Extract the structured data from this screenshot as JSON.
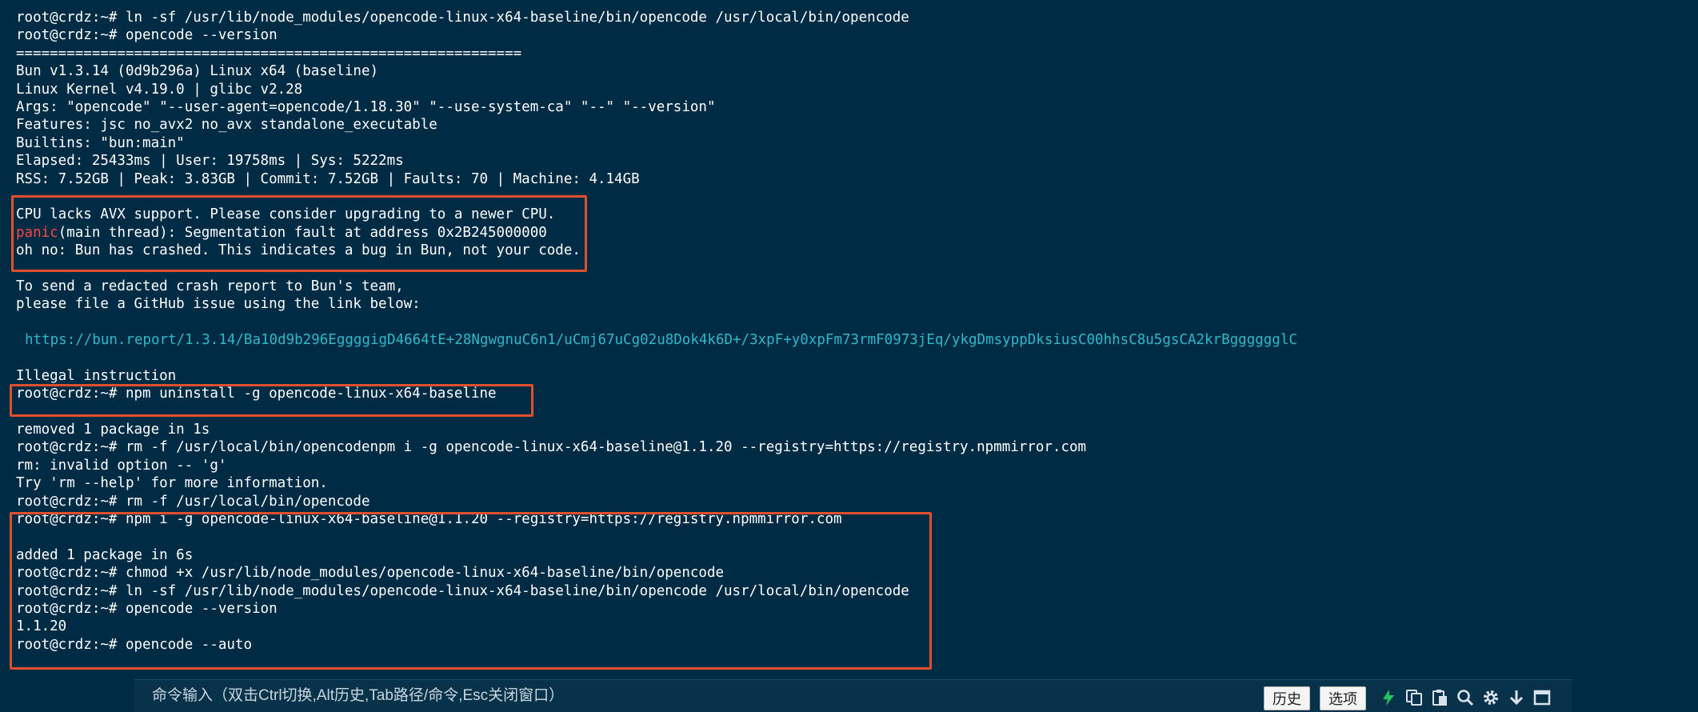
{
  "terminal": {
    "lines": [
      {
        "text": "root@crdz:~# ln -sf /usr/lib/node_modules/opencode-linux-x64-baseline/bin/opencode /usr/local/bin/opencode"
      },
      {
        "text": "root@crdz:~# opencode --version"
      },
      {
        "text": "============================================================"
      },
      {
        "text": "Bun v1.3.14 (0d9b296a) Linux x64 (baseline)"
      },
      {
        "text": "Linux Kernel v4.19.0 | glibc v2.28"
      },
      {
        "text": "Args: \"opencode\" \"--user-agent=opencode/1.18.30\" \"--use-system-ca\" \"--\" \"--version\""
      },
      {
        "text": "Features: jsc no_avx2 no_avx standalone_executable"
      },
      {
        "text": "Builtins: \"bun:main\""
      },
      {
        "text": "Elapsed: 25433ms | User: 19758ms | Sys: 5222ms"
      },
      {
        "text": "RSS: 7.52GB | Peak: 3.83GB | Commit: 7.52GB | Faults: 70 | Machine: 4.14GB"
      },
      {
        "text": ""
      },
      {
        "text": "CPU lacks AVX support. Please consider upgrading to a newer CPU."
      },
      {
        "prefix": "panic",
        "text": "(main thread): Segmentation fault at address 0x2B245000000"
      },
      {
        "text": "oh no: Bun has crashed. This indicates a bug in Bun, not your code."
      },
      {
        "text": ""
      },
      {
        "text": "To send a redacted crash report to Bun's team,"
      },
      {
        "text": "please file a GitHub issue using the link below:"
      },
      {
        "text": ""
      },
      {
        "link": true,
        "text": "https://bun.report/1.3.14/Ba10d9b296EggggigD4664tE+28NgwgnuC6n1/uCmj67uCg02u8Dok4k6D+/3xpF+y0xpFm73rmF0973jEq/ykgDmsyppDksiusC00hhsC8u5gsCA2krBgggggglC"
      },
      {
        "text": ""
      },
      {
        "text": "Illegal instruction"
      },
      {
        "text": "root@crdz:~# npm uninstall -g opencode-linux-x64-baseline"
      },
      {
        "text": ""
      },
      {
        "text": "removed 1 package in 1s"
      },
      {
        "text": "root@crdz:~# rm -f /usr/local/bin/opencodenpm i -g opencode-linux-x64-baseline@1.1.20 --registry=https://registry.npmmirror.com"
      },
      {
        "text": "rm: invalid option -- 'g'"
      },
      {
        "text": "Try 'rm --help' for more information."
      },
      {
        "text": "root@crdz:~# rm -f /usr/local/bin/opencode"
      },
      {
        "text": "root@crdz:~# npm i -g opencode-linux-x64-baseline@1.1.20 --registry=https://registry.npmmirror.com"
      },
      {
        "text": ""
      },
      {
        "text": "added 1 package in 6s"
      },
      {
        "text": "root@crdz:~# chmod +x /usr/lib/node_modules/opencode-linux-x64-baseline/bin/opencode"
      },
      {
        "text": "root@crdz:~# ln -sf /usr/lib/node_modules/opencode-linux-x64-baseline/bin/opencode /usr/local/bin/opencode"
      },
      {
        "text": "root@crdz:~# opencode --version"
      },
      {
        "text": "1.1.20"
      },
      {
        "text": "root@crdz:~# opencode --auto"
      }
    ]
  },
  "command_bar": {
    "placeholder": "命令输入（双击Ctrl切换,Alt历史,Tab路径/命令,Esc关闭窗口）",
    "history_label": "历史",
    "options_label": "选项",
    "tools": [
      "lightning-icon",
      "copy-icon",
      "paste-icon",
      "search-icon",
      "gear-icon",
      "download-icon",
      "window-icon"
    ]
  },
  "colors": {
    "background": "#002b45",
    "text": "#ffffff",
    "link": "#2fb8c8",
    "panic": "#ff4545",
    "highlight_box": "#e0502c",
    "lightning": "#22c55e"
  }
}
